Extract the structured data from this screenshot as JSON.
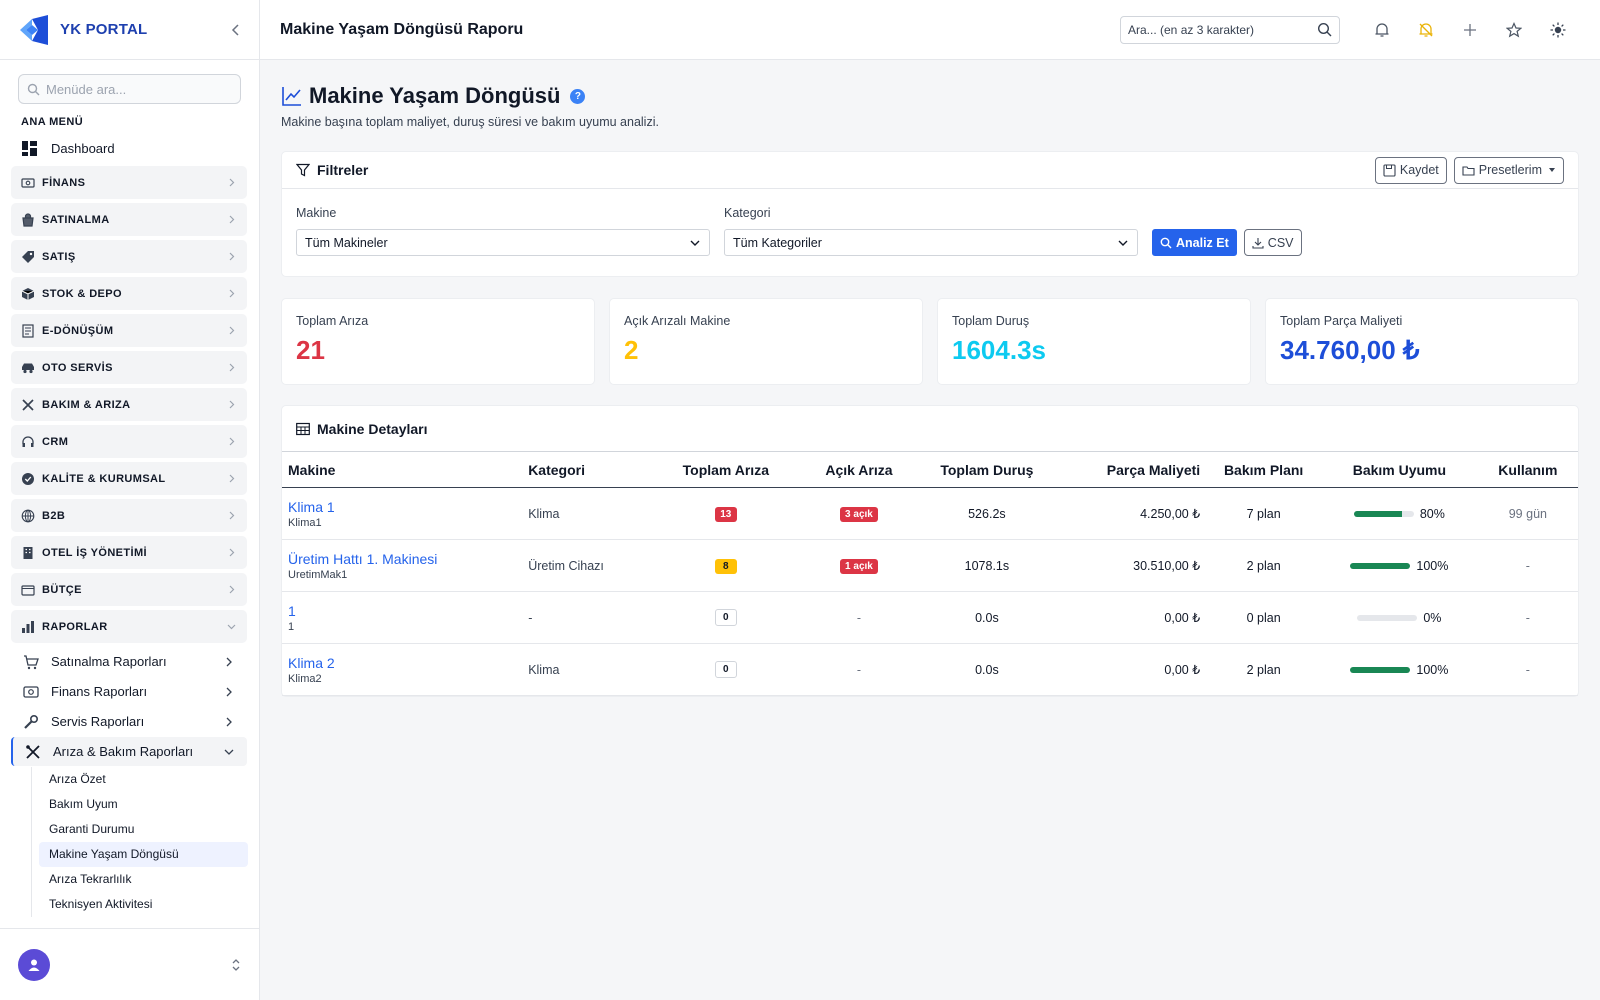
{
  "brand": {
    "name": "YK PORTAL"
  },
  "sidebar": {
    "search_placeholder": "Menüde ara...",
    "section_title": "ANA MENÜ",
    "dashboard": "Dashboard",
    "groups": [
      "FİNANS",
      "SATINALMA",
      "SATIŞ",
      "STOK & DEPO",
      "E-DÖNÜŞÜM",
      "OTO SERVİS",
      "BAKIM & ARIZA",
      "CRM",
      "KALİTE & KURUMSAL",
      "B2B",
      "OTEL İŞ YÖNETİMİ",
      "BÜTÇE",
      "RAPORLAR"
    ],
    "report_items": [
      "Satınalma Raporları",
      "Finans Raporları",
      "Servis Raporları",
      "Arıza & Bakım Raporları"
    ],
    "leaf_items": [
      "Arıza Özet",
      "Bakım Uyum",
      "Garanti Durumu",
      "Makine Yaşam Döngüsü",
      "Arıza Tekrarlılık",
      "Teknisyen Aktivitesi"
    ]
  },
  "topbar": {
    "title": "Makine Yaşam Döngüsü Raporu",
    "search_placeholder": "Ara... (en az 3 karakter)"
  },
  "page": {
    "title": "Makine Yaşam Döngüsü",
    "description": "Makine başına toplam maliyet, duruş süresi ve bakım uyumu analizi.",
    "help": "?"
  },
  "filters": {
    "title": "Filtreler",
    "save": "Kaydet",
    "presets": "Presetlerim",
    "machine_label": "Makine",
    "machine_value": "Tüm Makineler",
    "category_label": "Kategori",
    "category_value": "Tüm Kategoriler",
    "analyze": "Analiz Et",
    "csv": "CSV"
  },
  "stats": [
    {
      "label": "Toplam Arıza",
      "value": "21",
      "color": "#dc3545"
    },
    {
      "label": "Açık Arızalı Makine",
      "value": "2",
      "color": "#ffc107"
    },
    {
      "label": "Toplam Duruş",
      "value": "1604.3s",
      "color": "#0dcaf0"
    },
    {
      "label": "Toplam Parça Maliyeti",
      "value": "34.760,00 ₺",
      "color": "#1d4ed8"
    }
  ],
  "details": {
    "title": "Makine Detayları",
    "columns": [
      "Makine",
      "Kategori",
      "Toplam Arıza",
      "Açık Arıza",
      "Toplam Duruş",
      "Parça Maliyeti",
      "Bakım Planı",
      "Bakım Uyumu",
      "Kullanım"
    ],
    "rows": [
      {
        "name": "Klima 1",
        "code": "Klima1",
        "category": "Klima",
        "total_faults": "13",
        "total_badge": "red",
        "open_faults": "3 açık",
        "downtime": "526.2s",
        "part_cost": "4.250,00 ₺",
        "plan": "7 plan",
        "compliance": "80%",
        "compliance_pct": 80,
        "usage": "99 gün"
      },
      {
        "name": "Üretim Hattı 1. Makinesi",
        "code": "UretimMak1",
        "category": "Üretim Cihazı",
        "total_faults": "8",
        "total_badge": "yellow",
        "open_faults": "1 açık",
        "downtime": "1078.1s",
        "part_cost": "30.510,00 ₺",
        "plan": "2 plan",
        "compliance": "100%",
        "compliance_pct": 100,
        "usage": "-"
      },
      {
        "name": "1",
        "code": "1",
        "category": "-",
        "total_faults": "0",
        "total_badge": "light",
        "open_faults": "-",
        "downtime": "0.0s",
        "part_cost": "0,00 ₺",
        "plan": "0 plan",
        "compliance": "0%",
        "compliance_pct": 0,
        "usage": "-"
      },
      {
        "name": "Klima 2",
        "code": "Klima2",
        "category": "Klima",
        "total_faults": "0",
        "total_badge": "light",
        "open_faults": "-",
        "downtime": "0.0s",
        "part_cost": "0,00 ₺",
        "plan": "2 plan",
        "compliance": "100%",
        "compliance_pct": 100,
        "usage": "-"
      }
    ]
  },
  "colors": {
    "accent": "#2563eb",
    "success": "#198754",
    "danger": "#dc3545",
    "warning": "#ffc107",
    "info": "#0dcaf0"
  }
}
